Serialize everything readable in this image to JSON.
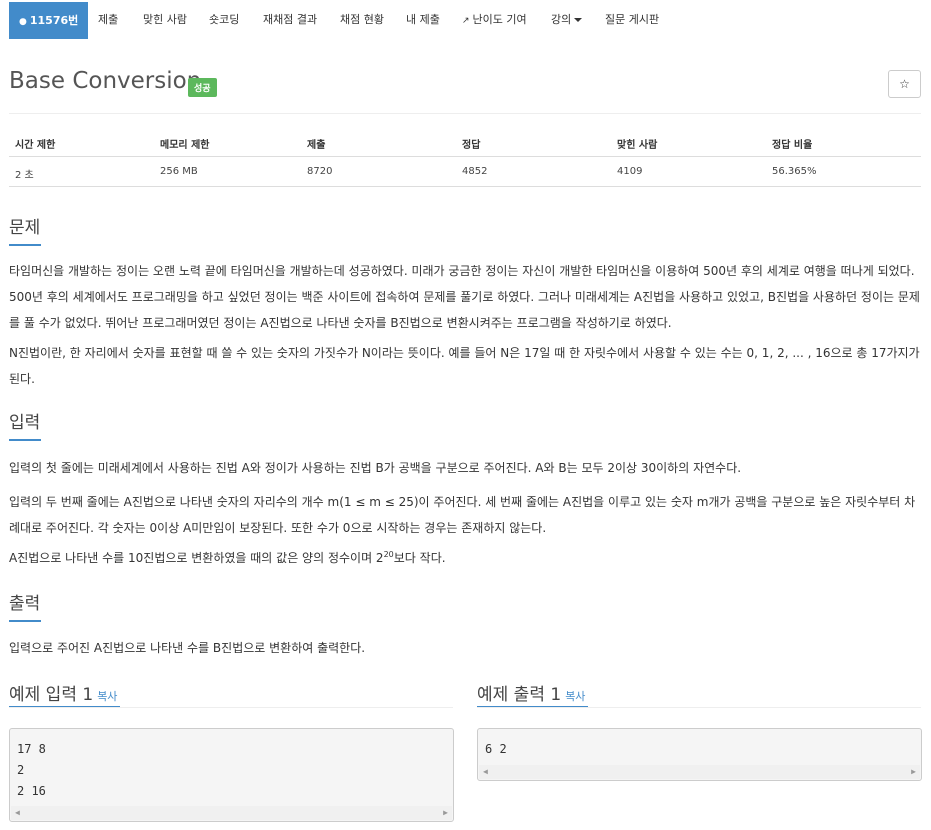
{
  "nav": {
    "problem_num": "11576번",
    "items": [
      "제출",
      "맞힌 사람",
      "숏코딩",
      "재채점 결과",
      "채점 현황",
      "내 제출",
      "난이도 기여",
      "강의",
      "질문 게시판"
    ]
  },
  "title": "Base Conversion",
  "badge": "성공",
  "star": "☆",
  "stats": {
    "headers": [
      "시간 제한",
      "메모리 제한",
      "제출",
      "정답",
      "맞힌 사람",
      "정답 비율"
    ],
    "values": [
      "2 초",
      "256 MB",
      "8720",
      "4852",
      "4109",
      "56.365%"
    ]
  },
  "sections": {
    "problem": {
      "heading": "문제",
      "p1": "타임머신을 개발하는 정이는 오랜 노력 끝에 타임머신을 개발하는데 성공하였다. 미래가 궁금한 정이는 자신이 개발한 타임머신을 이용하여 500년 후의 세계로 여행을 떠나게 되었다. 500년 후의 세계에서도 프로그래밍을 하고 싶었던 정이는 백준 사이트에 접속하여 문제를 풀기로 하였다. 그러나 미래세계는 A진법을 사용하고 있었고, B진법을 사용하던 정이는 문제를 풀 수가 없었다. 뛰어난 프로그래머였던 정이는 A진법으로 나타낸 숫자를 B진법으로 변환시켜주는 프로그램을 작성하기로 하였다.",
      "p2": "N진법이란, 한 자리에서 숫자를 표현할 때 쓸 수 있는 숫자의 가짓수가 N이라는 뜻이다. 예를 들어 N은 17일 때 한 자릿수에서 사용할 수 있는 수는 0, 1, 2, ... , 16으로 총 17가지가 된다."
    },
    "input": {
      "heading": "입력",
      "p1": "입력의 첫 줄에는 미래세계에서 사용하는 진법 A와 정이가 사용하는 진법 B가 공백을 구분으로 주어진다. A와 B는 모두 2이상 30이하의 자연수다.",
      "p2": "입력의 두 번째 줄에는 A진법으로 나타낸 숫자의 자리수의 개수 m(1 ≤ m ≤ 25)이 주어진다. 세 번째 줄에는 A진법을 이루고 있는 숫자 m개가 공백을 구분으로 높은 자릿수부터 차례대로 주어진다. 각 숫자는 0이상 A미만임이 보장된다. 또한 수가 0으로 시작하는 경우는 존재하지 않는다.",
      "p3_pre": "A진법으로 나타낸 수를 10진법으로 변환하였을 때의 값은 양의 정수이며 2",
      "p3_sup": "20",
      "p3_post": "보다 작다."
    },
    "output": {
      "heading": "출력",
      "p1": "입력으로 주어진 A진법으로 나타낸 수를 B진법으로 변환하여 출력한다."
    }
  },
  "samples": {
    "input_title": "예제 입력 1",
    "output_title": "예제 출력 1",
    "copy_label": "복사",
    "input_lines": "17 8\n2\n2 16",
    "output_lines": "6 2"
  }
}
